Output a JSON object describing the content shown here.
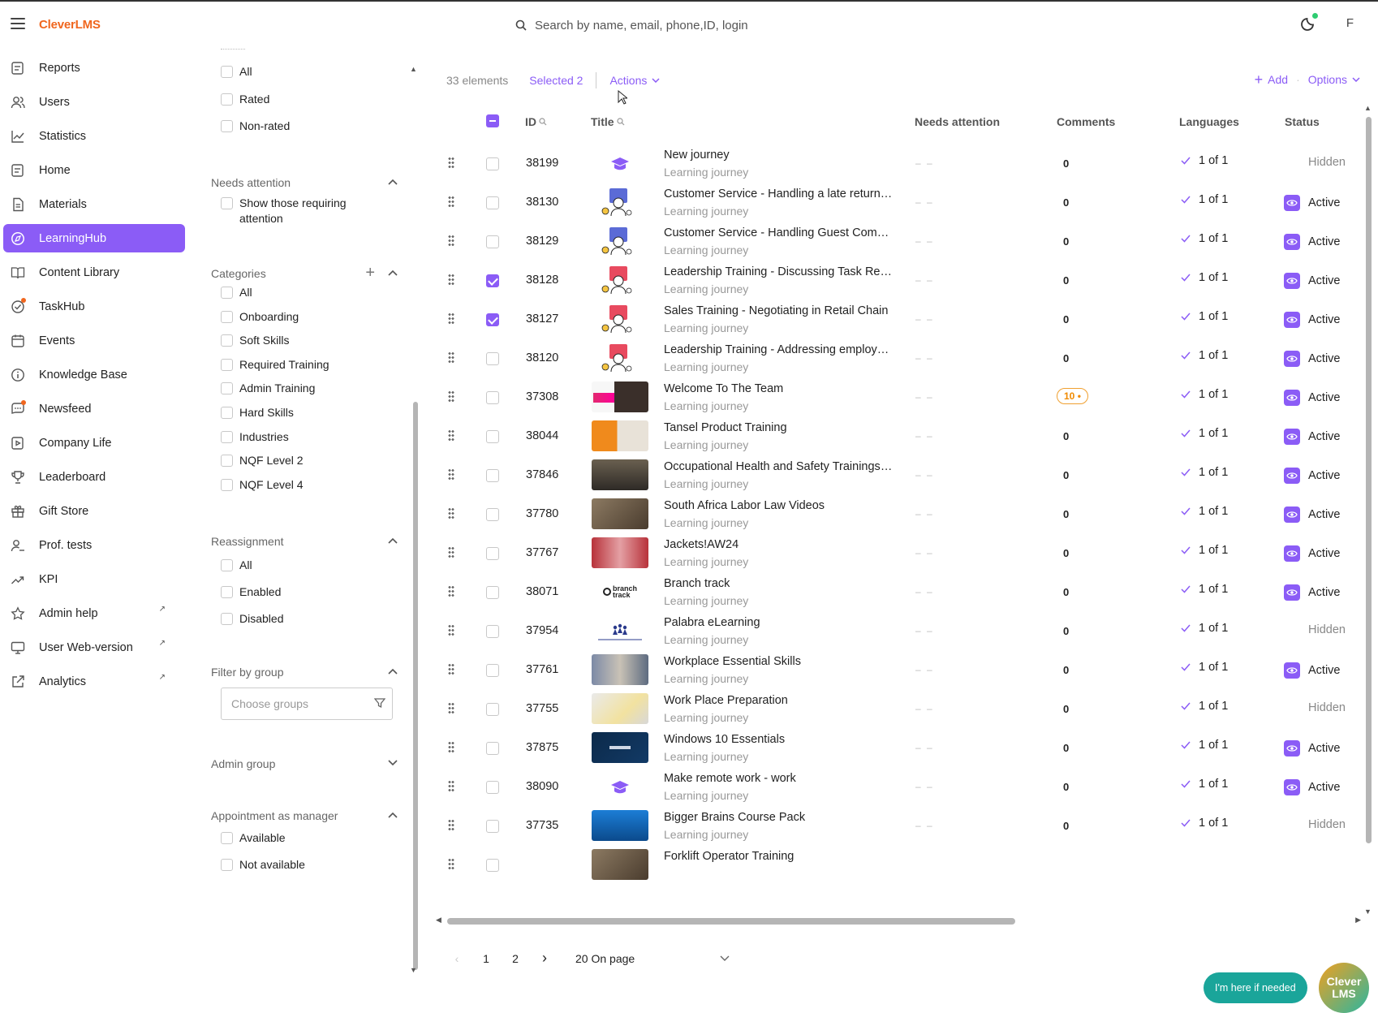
{
  "app": {
    "logo": "CleverLMS",
    "avatar_letter": "F"
  },
  "search": {
    "placeholder": "Search by name, email, phone,ID, login"
  },
  "sidebar": {
    "items": [
      {
        "label": "Reports",
        "icon": "reports-icon"
      },
      {
        "label": "Users",
        "icon": "users-icon"
      },
      {
        "label": "Statistics",
        "icon": "statistics-icon"
      },
      {
        "label": "Home",
        "icon": "home-icon"
      },
      {
        "label": "Materials",
        "icon": "materials-icon"
      },
      {
        "label": "LearningHub",
        "icon": "learninghub-icon",
        "active": true
      },
      {
        "label": "Content Library",
        "icon": "book-icon"
      },
      {
        "label": "TaskHub",
        "icon": "taskhub-icon"
      },
      {
        "label": "Events",
        "icon": "calendar-icon"
      },
      {
        "label": "Knowledge Base",
        "icon": "info-icon"
      },
      {
        "label": "Newsfeed",
        "icon": "newsfeed-icon"
      },
      {
        "label": "Company Life",
        "icon": "company-life-icon"
      },
      {
        "label": "Leaderboard",
        "icon": "trophy-icon"
      },
      {
        "label": "Gift Store",
        "icon": "gift-icon"
      },
      {
        "label": "Prof. tests",
        "icon": "prof-tests-icon"
      },
      {
        "label": "KPI",
        "icon": "kpi-icon"
      },
      {
        "label": "Admin help",
        "icon": "star-icon"
      },
      {
        "label": "User Web-version",
        "icon": "monitor-icon"
      },
      {
        "label": "Analytics",
        "icon": "external-link-icon"
      }
    ]
  },
  "filters": {
    "rating": {
      "options": [
        "All",
        "Rated",
        "Non-rated"
      ]
    },
    "needs_attention": {
      "title": "Needs attention",
      "option1": "Show those requiring",
      "option2": "attention"
    },
    "categories": {
      "title": "Categories",
      "options": [
        "All",
        "Onboarding",
        "Soft Skills",
        "Required Training",
        "Admin Training",
        "Hard Skills",
        "Industries",
        "NQF Level 2",
        "NQF Level 4"
      ]
    },
    "reassignment": {
      "title": "Reassignment",
      "options": [
        "All",
        "Enabled",
        "Disabled"
      ]
    },
    "filter_by_group": {
      "title": "Filter by group",
      "placeholder": "Choose groups"
    },
    "admin_group": {
      "title": "Admin group"
    },
    "appointment": {
      "title": "Appointment as manager",
      "options": [
        "Available",
        "Not available"
      ]
    }
  },
  "toolbar": {
    "count": "33 elements",
    "selected": "Selected 2",
    "actions": "Actions",
    "add": "Add",
    "options": "Options"
  },
  "table": {
    "headers": {
      "id": "ID",
      "title": "Title",
      "needs_attention": "Needs attention",
      "comments": "Comments",
      "languages": "Languages",
      "status": "Status"
    },
    "rows": [
      {
        "id": "38199",
        "title": "New journey",
        "sub": "Learning journey",
        "na": "– –",
        "comments": "0",
        "lang": "1 of 1",
        "status": "Hidden",
        "checked": false,
        "thumb": "cap"
      },
      {
        "id": "38130",
        "title": "Customer Service - Handling a late return r...",
        "sub": "Learning journey",
        "na": "– –",
        "comments": "0",
        "lang": "1 of 1",
        "status": "Active",
        "checked": false,
        "thumb": "illus-blue"
      },
      {
        "id": "38129",
        "title": "Customer Service - Handling Guest Compla...",
        "sub": "Learning journey",
        "na": "– –",
        "comments": "0",
        "lang": "1 of 1",
        "status": "Active",
        "checked": false,
        "thumb": "illus-blue"
      },
      {
        "id": "38128",
        "title": "Leadership Training - Discussing Task Resu...",
        "sub": "Learning journey",
        "na": "– –",
        "comments": "0",
        "lang": "1 of 1",
        "status": "Active",
        "checked": true,
        "thumb": "illus-red"
      },
      {
        "id": "38127",
        "title": "Sales Training - Negotiating in Retail Chain",
        "sub": "Learning journey",
        "na": "– –",
        "comments": "0",
        "lang": "1 of 1",
        "status": "Active",
        "checked": true,
        "thumb": "illus-red"
      },
      {
        "id": "38120",
        "title": "Leadership Training - Addressing employee...",
        "sub": "Learning journey",
        "na": "– –",
        "comments": "0",
        "lang": "1 of 1",
        "status": "Active",
        "checked": false,
        "thumb": "illus-red"
      },
      {
        "id": "37308",
        "title": "Welcome To The Team",
        "sub": "Learning journey",
        "na": "– –",
        "comments": "10",
        "lang": "1 of 1",
        "status": "Active",
        "checked": false,
        "thumb": "photo-pink"
      },
      {
        "id": "38044",
        "title": "Tansel Product Training",
        "sub": "Learning journey",
        "na": "– –",
        "comments": "0",
        "lang": "1 of 1",
        "status": "Active",
        "checked": false,
        "thumb": "photo-orange"
      },
      {
        "id": "37846",
        "title": "Occupational Health and Safety Trainings a...",
        "sub": "Learning journey",
        "na": "– –",
        "comments": "0",
        "lang": "1 of 1",
        "status": "Active",
        "checked": false,
        "thumb": "photo-crowd"
      },
      {
        "id": "37780",
        "title": "South Africa Labor Law Videos",
        "sub": "Learning journey",
        "na": "– –",
        "comments": "0",
        "lang": "1 of 1",
        "status": "Active",
        "checked": false,
        "thumb": "photo-brown"
      },
      {
        "id": "37767",
        "title": "Jackets!AW24",
        "sub": "Learning journey",
        "na": "– –",
        "comments": "0",
        "lang": "1 of 1",
        "status": "Active",
        "checked": false,
        "thumb": "photo-red"
      },
      {
        "id": "38071",
        "title": "Branch track",
        "sub": "Learning journey",
        "na": "– –",
        "comments": "0",
        "lang": "1 of 1",
        "status": "Active",
        "checked": false,
        "thumb": "logo-branch"
      },
      {
        "id": "37954",
        "title": "Palabra eLearning",
        "sub": "Learning journey",
        "na": "– –",
        "comments": "0",
        "lang": "1 of 1",
        "status": "Hidden",
        "checked": false,
        "thumb": "logo-palabra"
      },
      {
        "id": "37761",
        "title": "Workplace Essential Skills",
        "sub": "Learning journey",
        "na": "– –",
        "comments": "0",
        "lang": "1 of 1",
        "status": "Active",
        "checked": false,
        "thumb": "photo-office"
      },
      {
        "id": "37755",
        "title": "Work Place Preparation",
        "sub": "Learning journey",
        "na": "– –",
        "comments": "0",
        "lang": "1 of 1",
        "status": "Hidden",
        "checked": false,
        "thumb": "photo-desk"
      },
      {
        "id": "37875",
        "title": "Windows 10 Essentials",
        "sub": "Learning journey",
        "na": "– –",
        "comments": "0",
        "lang": "1 of 1",
        "status": "Active",
        "checked": false,
        "thumb": "photo-dark"
      },
      {
        "id": "38090",
        "title": "Make remote work - work",
        "sub": "Learning journey",
        "na": "– –",
        "comments": "0",
        "lang": "1 of 1",
        "status": "Active",
        "checked": false,
        "thumb": "cap"
      },
      {
        "id": "37735",
        "title": "Bigger Brains Course Pack",
        "sub": "Learning journey",
        "na": "– –",
        "comments": "0",
        "lang": "1 of 1",
        "status": "Hidden",
        "checked": false,
        "thumb": "photo-blue"
      },
      {
        "id": "",
        "title": "Forklift Operator Training",
        "sub": "",
        "na": "",
        "comments": "",
        "lang": "",
        "status": "",
        "checked": false,
        "thumb": "photo-brown"
      }
    ]
  },
  "pagination": {
    "pages": [
      "1",
      "2"
    ],
    "per_page": "20 On page"
  },
  "chat": {
    "label": "I'm here if needed",
    "logo_line1": "Clever",
    "logo_line2": "LMS"
  },
  "colors": {
    "accent": "#8b5cf6",
    "brand_orange": "#f0661e",
    "chat": "#1aa59a"
  }
}
